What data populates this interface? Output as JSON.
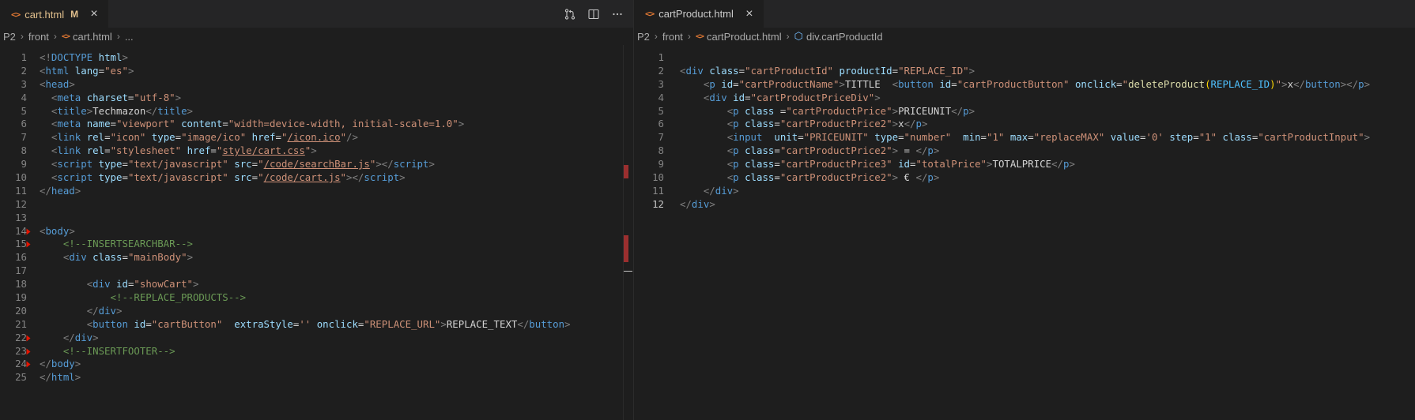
{
  "left": {
    "tab": {
      "label": "cart.html",
      "badge": "M"
    },
    "breadcrumb": [
      "P2",
      "front",
      "cart.html",
      "..."
    ],
    "lines": [
      {
        "n": "1",
        "html": "<span class='tg'>&lt;!</span><span class='tn'>DOCTYPE</span> <span class='at'>html</span><span class='tg'>&gt;</span>"
      },
      {
        "n": "2",
        "html": "<span class='tg'>&lt;</span><span class='tn'>html</span> <span class='at'>lang</span>=<span class='st'>\"es\"</span><span class='tg'>&gt;</span>"
      },
      {
        "n": "3",
        "html": "<span class='tg'>&lt;</span><span class='tn'>head</span><span class='tg'>&gt;</span>"
      },
      {
        "n": "4",
        "html": "  <span class='tg'>&lt;</span><span class='tn'>meta</span> <span class='at'>charset</span>=<span class='st'>\"utf-8\"</span><span class='tg'>&gt;</span>"
      },
      {
        "n": "5",
        "html": "  <span class='tg'>&lt;</span><span class='tn'>title</span><span class='tg'>&gt;</span>Techmazon<span class='tg'>&lt;/</span><span class='tn'>title</span><span class='tg'>&gt;</span>"
      },
      {
        "n": "6",
        "html": "  <span class='tg'>&lt;</span><span class='tn'>meta</span> <span class='at'>name</span>=<span class='st'>\"viewport\"</span> <span class='at'>content</span>=<span class='st'>\"width=device-width, initial-scale=1.0\"</span><span class='tg'>&gt;</span>"
      },
      {
        "n": "7",
        "html": "  <span class='tg'>&lt;</span><span class='tn'>link</span> <span class='at'>rel</span>=<span class='st'>\"icon\"</span> <span class='at'>type</span>=<span class='st'>\"image/ico\"</span> <span class='at'>href</span>=<span class='st'>\"<span class='ul'>/icon.ico</span>\"</span><span class='tg'>/&gt;</span>"
      },
      {
        "n": "8",
        "html": "  <span class='tg'>&lt;</span><span class='tn'>link</span> <span class='at'>rel</span>=<span class='st'>\"stylesheet\"</span> <span class='at'>href</span>=<span class='st'>\"<span class='ul'>style/cart.css</span>\"</span><span class='tg'>&gt;</span>"
      },
      {
        "n": "9",
        "html": "  <span class='tg'>&lt;</span><span class='tn'>script</span> <span class='at'>type</span>=<span class='st'>\"text/javascript\"</span> <span class='at'>src</span>=<span class='st'>\"<span class='ul'>/code/searchBar.js</span>\"</span><span class='tg'>&gt;&lt;/</span><span class='tn'>script</span><span class='tg'>&gt;</span>"
      },
      {
        "n": "10",
        "html": "  <span class='tg'>&lt;</span><span class='tn'>script</span> <span class='at'>type</span>=<span class='st'>\"text/javascript\"</span> <span class='at'>src</span>=<span class='st'>\"<span class='ul'>/code/cart.js</span>\"</span><span class='tg'>&gt;&lt;/</span><span class='tn'>script</span><span class='tg'>&gt;</span>"
      },
      {
        "n": "11",
        "html": "<span class='tg'>&lt;/</span><span class='tn'>head</span><span class='tg'>&gt;</span>"
      },
      {
        "n": "12",
        "html": ""
      },
      {
        "n": "13",
        "html": ""
      },
      {
        "n": "14",
        "html": "<span class='tg'>&lt;</span><span class='tn'>body</span><span class='tg'>&gt;</span>",
        "fold": true
      },
      {
        "n": "15",
        "html": "    <span class='cm'>&lt;!--INSERTSEARCHBAR--&gt;</span>",
        "fold": true
      },
      {
        "n": "16",
        "html": "    <span class='tg'>&lt;</span><span class='tn'>div</span> <span class='at'>class</span>=<span class='st'>\"mainBody\"</span><span class='tg'>&gt;</span>"
      },
      {
        "n": "17",
        "html": ""
      },
      {
        "n": "18",
        "html": "        <span class='tg'>&lt;</span><span class='tn'>div</span> <span class='at'>id</span>=<span class='st'>\"showCart\"</span><span class='tg'>&gt;</span>"
      },
      {
        "n": "19",
        "html": "            <span class='cm'>&lt;!--REPLACE_PRODUCTS--&gt;</span>"
      },
      {
        "n": "20",
        "html": "        <span class='tg'>&lt;/</span><span class='tn'>div</span><span class='tg'>&gt;</span>"
      },
      {
        "n": "21",
        "html": "        <span class='tg'>&lt;</span><span class='tn'>button</span> <span class='at'>id</span>=<span class='st'>\"cartButton\"</span>  <span class='at'>extraStyle</span>=<span class='st'>''</span> <span class='at'>onclick</span>=<span class='st'>\"REPLACE_URL\"</span><span class='tg'>&gt;</span>REPLACE_TEXT<span class='tg'>&lt;/</span><span class='tn'>button</span><span class='tg'>&gt;</span>"
      },
      {
        "n": "22",
        "html": "    <span class='tg'>&lt;/</span><span class='tn'>div</span><span class='tg'>&gt;</span>",
        "fold": true
      },
      {
        "n": "23",
        "html": "    <span class='cm'>&lt;!--INSERTFOOTER--&gt;</span>",
        "fold": true
      },
      {
        "n": "24",
        "html": "<span class='tg'>&lt;/</span><span class='tn'>body</span><span class='tg'>&gt;</span>",
        "fold": true
      },
      {
        "n": "25",
        "html": "<span class='tg'>&lt;/</span><span class='tn'>html</span><span class='tg'>&gt;</span>"
      }
    ]
  },
  "right": {
    "tab": {
      "label": "cartProduct.html"
    },
    "breadcrumb": [
      "P2",
      "front",
      "cartProduct.html",
      "div.cartProductId"
    ],
    "lines": [
      {
        "n": "1",
        "html": ""
      },
      {
        "n": "2",
        "html": "<span class='tg'>&lt;</span><span class='tn'>div</span> <span class='at'>class</span>=<span class='st'>\"cartProductId\"</span> <span class='at'>productId</span>=<span class='st'>\"REPLACE_ID\"</span><span class='tg'>&gt;</span>"
      },
      {
        "n": "3",
        "html": "    <span class='tg'>&lt;</span><span class='tn'>p</span> <span class='at'>id</span>=<span class='st'>\"cartProductName\"</span><span class='tg'>&gt;</span>TITTLE  <span class='tg'>&lt;</span><span class='tn'>button</span> <span class='at'>id</span>=<span class='st'>\"cartProductButton\"</span> <span class='at'>onclick</span>=<span class='st'>\"<span class='fn'>deleteProduct</span><span class='bk'>(</span><span class='vr'>REPLACE_ID</span><span class='bk'>)</span>\"</span><span class='tg'>&gt;</span>x<span class='tg'>&lt;/</span><span class='tn'>button</span><span class='tg'>&gt;&lt;/</span><span class='tn'>p</span><span class='tg'>&gt;</span>"
      },
      {
        "n": "4",
        "html": "    <span class='tg'>&lt;</span><span class='tn'>div</span> <span class='at'>id</span>=<span class='st'>\"cartProductPriceDiv\"</span><span class='tg'>&gt;</span>"
      },
      {
        "n": "5",
        "html": "        <span class='tg'>&lt;</span><span class='tn'>p</span> <span class='at'>class</span> =<span class='st'>\"cartProductPrice\"</span><span class='tg'>&gt;</span>PRICEUNIT<span class='tg'>&lt;/</span><span class='tn'>p</span><span class='tg'>&gt;</span>"
      },
      {
        "n": "6",
        "html": "        <span class='tg'>&lt;</span><span class='tn'>p</span> <span class='at'>class</span>=<span class='st'>\"cartProductPrice2\"</span><span class='tg'>&gt;</span>x<span class='tg'>&lt;/</span><span class='tn'>p</span><span class='tg'>&gt;</span>"
      },
      {
        "n": "7",
        "html": "        <span class='tg'>&lt;</span><span class='tn'>input</span>  <span class='at'>unit</span>=<span class='st'>\"PRICEUNIT\"</span> <span class='at'>type</span>=<span class='st'>\"number\"</span>  <span class='at'>min</span>=<span class='st'>\"1\"</span> <span class='at'>max</span>=<span class='st'>\"replaceMAX\"</span> <span class='at'>value</span>=<span class='st'>'0'</span> <span class='at'>step</span>=<span class='st'>\"1\"</span> <span class='at'>class</span>=<span class='st'>\"cartProductInput\"</span><span class='tg'>&gt;</span>"
      },
      {
        "n": "8",
        "html": "        <span class='tg'>&lt;</span><span class='tn'>p</span> <span class='at'>class</span>=<span class='st'>\"cartProductPrice2\"</span><span class='tg'>&gt;</span> = <span class='tg'>&lt;/</span><span class='tn'>p</span><span class='tg'>&gt;</span>"
      },
      {
        "n": "9",
        "html": "        <span class='tg'>&lt;</span><span class='tn'>p</span> <span class='at'>class</span>=<span class='st'>\"cartProductPrice3\"</span> <span class='at'>id</span>=<span class='st'>\"totalPrice\"</span><span class='tg'>&gt;</span>TOTALPRICE<span class='tg'>&lt;/</span><span class='tn'>p</span><span class='tg'>&gt;</span>"
      },
      {
        "n": "10",
        "html": "        <span class='tg'>&lt;</span><span class='tn'>p</span> <span class='at'>class</span>=<span class='st'>\"cartProductPrice2\"</span><span class='tg'>&gt;</span> € <span class='tg'>&lt;/</span><span class='tn'>p</span><span class='tg'>&gt;</span>"
      },
      {
        "n": "11",
        "html": "    <span class='tg'>&lt;/</span><span class='tn'>div</span><span class='tg'>&gt;</span>"
      },
      {
        "n": "12",
        "html": "<span class='tg'>&lt;/</span><span class='tn'>div</span><span class='tg'>&gt;</span>",
        "current": true
      }
    ]
  }
}
